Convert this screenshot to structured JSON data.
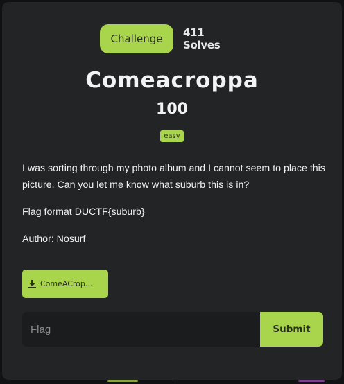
{
  "tabs": {
    "challenge_label": "Challenge",
    "solves_label": "411 Solves"
  },
  "challenge": {
    "name": "Comeacroppa",
    "points": "100",
    "difficulty": "easy",
    "description": [
      "I was sorting through my photo album and I cannot seem to place this picture. Can you let me know what suburb this is in?",
      "Flag format DUCTF{suburb}",
      "Author: Nosurf"
    ],
    "file_label": "ComeACrop..."
  },
  "flag_form": {
    "placeholder": "Flag",
    "submit_label": "Submit"
  },
  "colors": {
    "accent": "#a9d54d",
    "panel": "#232425",
    "background": "#111214"
  }
}
